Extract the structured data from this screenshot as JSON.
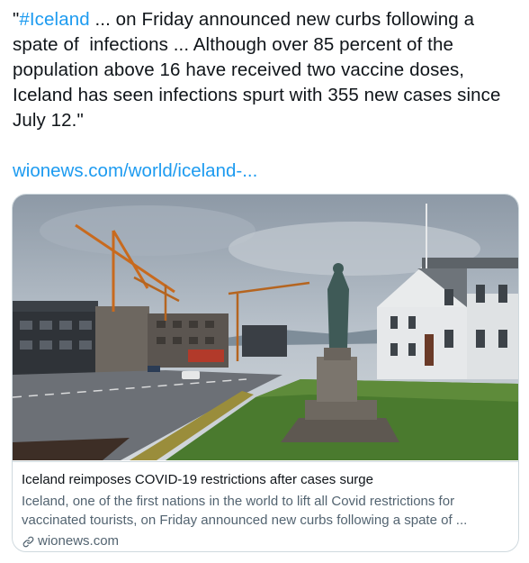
{
  "tweet": {
    "quote_open": "\"",
    "hashtag": "#Iceland",
    "text_rest": " ... on Friday announced new curbs following a spate of  infections ... Although over 85 percent of the population above 16 have received two vaccine doses, Iceland has seen infections spurt with 355 new cases since July 12.\"",
    "link_text": "wionews.com/world/iceland-..."
  },
  "card": {
    "image_icon": "photo-statue-crane",
    "title": "Iceland reimposes COVID-19 restrictions after cases surge",
    "description": "Iceland, one of the first nations in the world to lift all Covid restrictions for vaccinated tourists, on Friday announced new curbs following a spate of ...",
    "domain": "wionews.com",
    "domain_icon": "link-icon"
  },
  "colors": {
    "link": "#1d9bf0",
    "text": "#0f1419",
    "secondary": "#536471",
    "border": "#cfd9de"
  }
}
